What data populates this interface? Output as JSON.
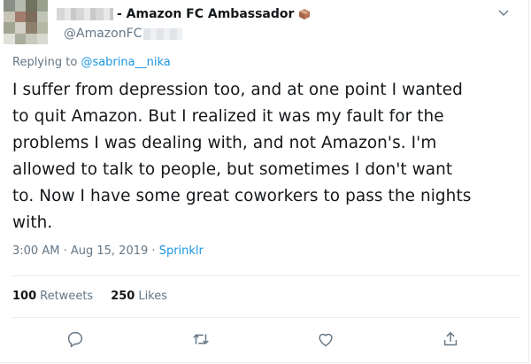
{
  "tweet": {
    "display_name": "- Amazon FC Ambassador",
    "handle": "@AmazonFC",
    "reply_prefix": "Replying to",
    "reply_mention": "@sabrina__nika",
    "text_lines": [
      "I suffer from depression too, and at one point I wanted",
      "to quit Amazon. But I realized it was my fault for the",
      "problems I was dealing with, and not Amazon's. I'm",
      "allowed to talk to people, but sometimes I don't want",
      "to. Now I have some great coworkers to pass the nights",
      "with."
    ],
    "time": "3:00 AM",
    "separator": "·",
    "date": "Aug 15, 2019",
    "source": "Sprinklr"
  },
  "stats": {
    "retweets_count": "100",
    "retweets_label": "Retweets",
    "likes_count": "250",
    "likes_label": "Likes"
  },
  "icons": {
    "badge": "package-box-icon",
    "caret": "chevron-down-icon",
    "reply": "reply-icon",
    "retweet": "retweet-icon",
    "like": "heart-icon",
    "share": "share-icon"
  },
  "colors": {
    "text": "#14171a",
    "secondary": "#657786",
    "link": "#1b95e0",
    "divider": "#e6ecf0"
  }
}
